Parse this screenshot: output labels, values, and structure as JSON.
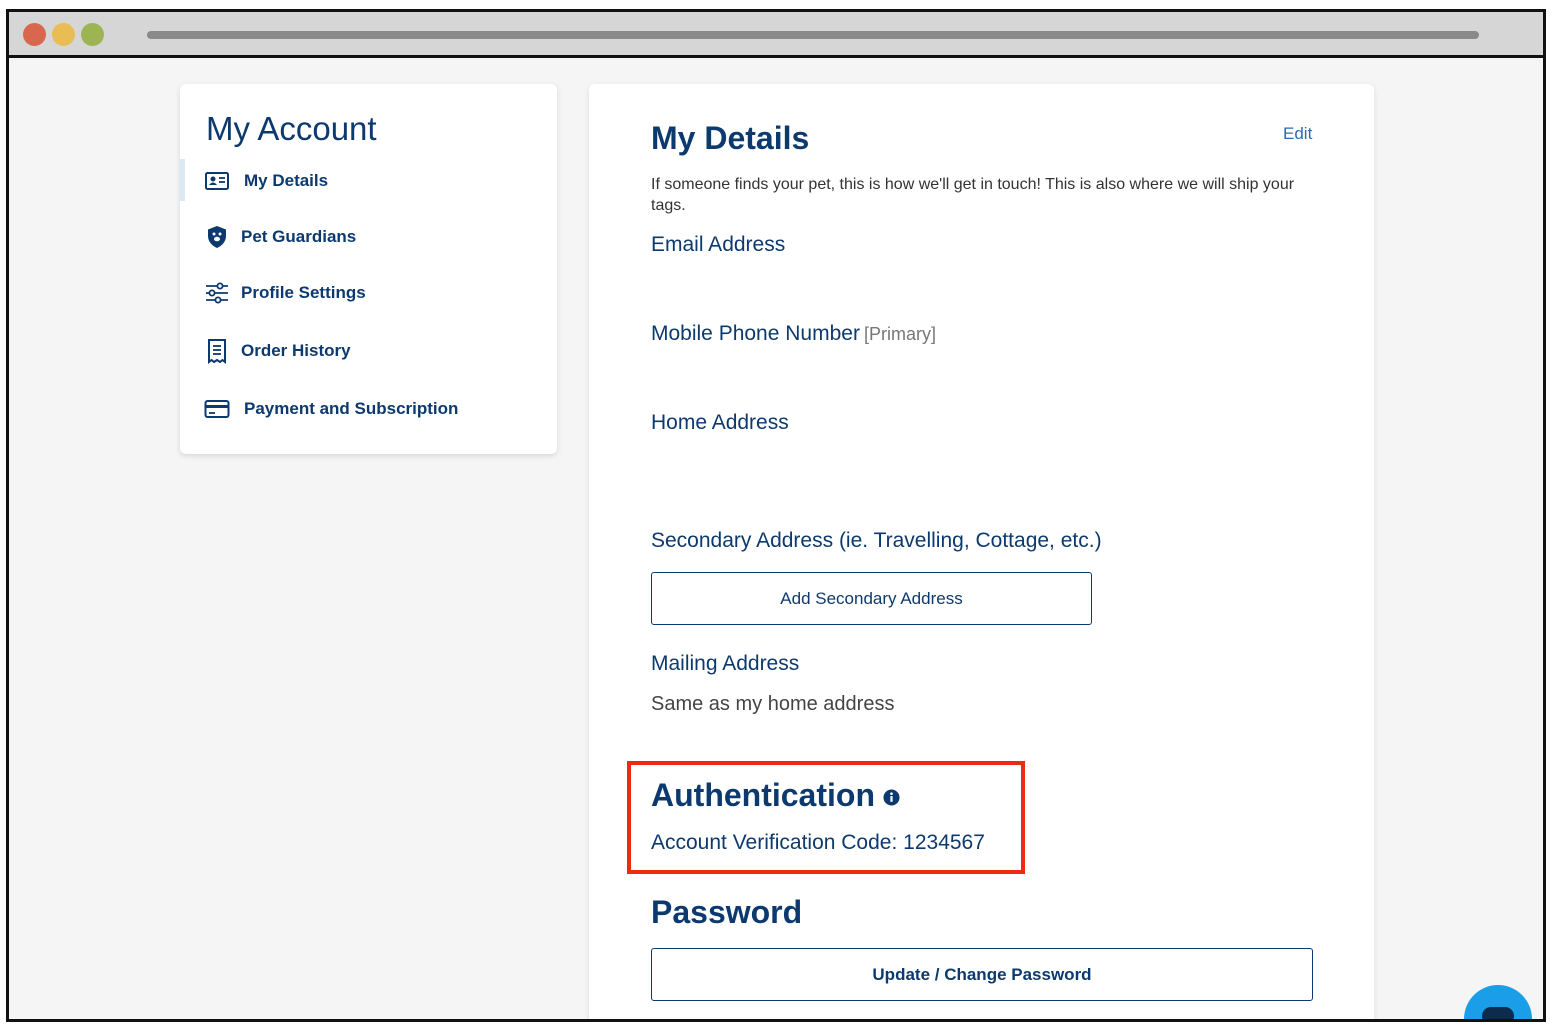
{
  "colors": {
    "primary": "#0d3a6e",
    "link": "#2a6bb5",
    "highlight": "#ee2b10",
    "chat": "#1a9ee8"
  },
  "sidebar": {
    "title": "My Account",
    "items": [
      {
        "label": "My Details",
        "icon": "id-card-icon",
        "active": true
      },
      {
        "label": "Pet Guardians",
        "icon": "shield-paw-icon",
        "active": false
      },
      {
        "label": "Profile Settings",
        "icon": "sliders-icon",
        "active": false
      },
      {
        "label": "Order History",
        "icon": "receipt-icon",
        "active": false
      },
      {
        "label": "Payment and Subscription",
        "icon": "credit-card-icon",
        "active": false
      }
    ]
  },
  "details": {
    "title": "My Details",
    "edit_label": "Edit",
    "description": "If someone finds your pet, this is how we'll get in touch! This is also where we will ship your tags.",
    "email_label": "Email Address",
    "phone_label": "Mobile Phone Number",
    "phone_sub": "[Primary]",
    "home_label": "Home Address",
    "secondary_label": "Secondary Address (ie. Travelling, Cottage, etc.)",
    "add_secondary_button": "Add Secondary Address",
    "mailing_label": "Mailing Address",
    "mailing_value": "Same as my home address"
  },
  "authentication": {
    "title": "Authentication",
    "code_label": "Account Verification Code:",
    "code_value": "1234567"
  },
  "password": {
    "title": "Password",
    "button": "Update / Change Password"
  },
  "chat": {
    "icon": "chat-bubble-icon"
  }
}
